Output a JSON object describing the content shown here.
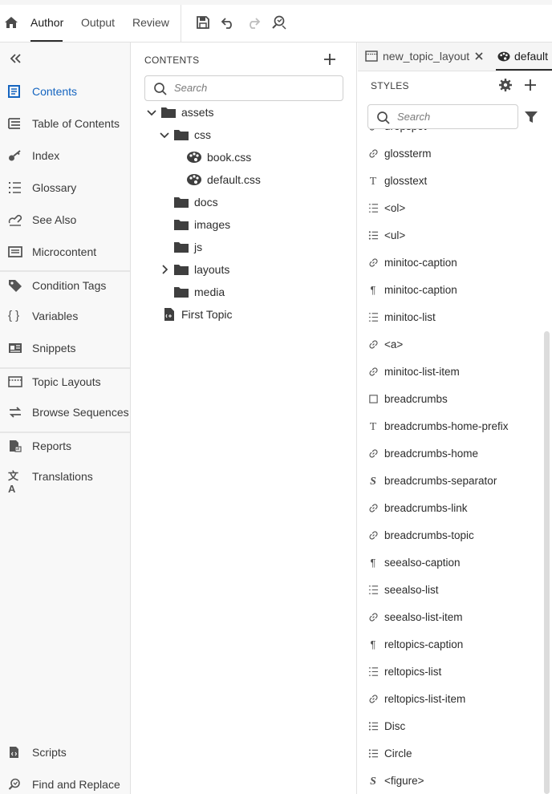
{
  "toolbar": {
    "tabs": [
      "Author",
      "Output",
      "Review"
    ],
    "active_tab": "Author"
  },
  "left_nav": {
    "items": [
      {
        "label": "Contents",
        "icon": "contents-icon",
        "active": true
      },
      {
        "label": "Table of Contents",
        "icon": "toc-icon"
      },
      {
        "label": "Index",
        "icon": "key-icon"
      },
      {
        "label": "Glossary",
        "icon": "glossary-icon"
      },
      {
        "label": "See Also",
        "icon": "see-also-icon"
      },
      {
        "label": "Microcontent",
        "icon": "microcontent-icon"
      },
      {
        "label": "Condition Tags",
        "icon": "tag-icon"
      },
      {
        "label": "Variables",
        "icon": "braces-icon"
      },
      {
        "label": "Snippets",
        "icon": "snippet-icon"
      },
      {
        "label": "Topic Layouts",
        "icon": "layout-icon"
      },
      {
        "label": "Browse Sequences",
        "icon": "browse-sequence-icon"
      },
      {
        "label": "Reports",
        "icon": "report-icon"
      },
      {
        "label": "Translations",
        "icon": "translate-icon"
      },
      {
        "label": "Scripts",
        "icon": "script-icon"
      },
      {
        "label": "Find and Replace",
        "icon": "find-replace-icon"
      }
    ]
  },
  "contents_panel": {
    "title": "CONTENTS",
    "search_placeholder": "Search",
    "tree": [
      {
        "label": "assets",
        "type": "folder",
        "expanded": true
      },
      {
        "label": "css",
        "type": "folder",
        "expanded": true
      },
      {
        "label": "book.css",
        "type": "css"
      },
      {
        "label": "default.css",
        "type": "css"
      },
      {
        "label": "docs",
        "type": "folder"
      },
      {
        "label": "images",
        "type": "folder"
      },
      {
        "label": "js",
        "type": "folder"
      },
      {
        "label": "layouts",
        "type": "folder",
        "expanded": false
      },
      {
        "label": "media",
        "type": "folder"
      },
      {
        "label": "First Topic",
        "type": "topic"
      }
    ]
  },
  "styles_panel": {
    "tabs": [
      {
        "label": "new_topic_layout",
        "closable": true
      },
      {
        "label": "default",
        "active": true
      }
    ],
    "title": "STYLES",
    "search_placeholder": "Search",
    "items": [
      {
        "label": "dropspot",
        "icon": "link"
      },
      {
        "label": "glossterm",
        "icon": "link"
      },
      {
        "label": "glosstext",
        "icon": "T"
      },
      {
        "label": "<ol>",
        "icon": "ol"
      },
      {
        "label": "<ul>",
        "icon": "ul"
      },
      {
        "label": "minitoc-caption",
        "icon": "link"
      },
      {
        "label": "minitoc-caption",
        "icon": "para"
      },
      {
        "label": "minitoc-list",
        "icon": "ol"
      },
      {
        "label": "<a>",
        "icon": "link"
      },
      {
        "label": "minitoc-list-item",
        "icon": "link"
      },
      {
        "label": "breadcrumbs",
        "icon": "box"
      },
      {
        "label": "breadcrumbs-home-prefix",
        "icon": "T"
      },
      {
        "label": "breadcrumbs-home",
        "icon": "link"
      },
      {
        "label": "breadcrumbs-separator",
        "icon": "S"
      },
      {
        "label": "breadcrumbs-link",
        "icon": "link"
      },
      {
        "label": "breadcrumbs-topic",
        "icon": "link"
      },
      {
        "label": "seealso-caption",
        "icon": "para"
      },
      {
        "label": "seealso-list",
        "icon": "ol"
      },
      {
        "label": "seealso-list-item",
        "icon": "link"
      },
      {
        "label": "reltopics-caption",
        "icon": "para"
      },
      {
        "label": "reltopics-list",
        "icon": "ol"
      },
      {
        "label": "reltopics-list-item",
        "icon": "link"
      },
      {
        "label": "Disc",
        "icon": "ul"
      },
      {
        "label": "Circle",
        "icon": "ul"
      },
      {
        "label": "<figure>",
        "icon": "S"
      }
    ]
  }
}
